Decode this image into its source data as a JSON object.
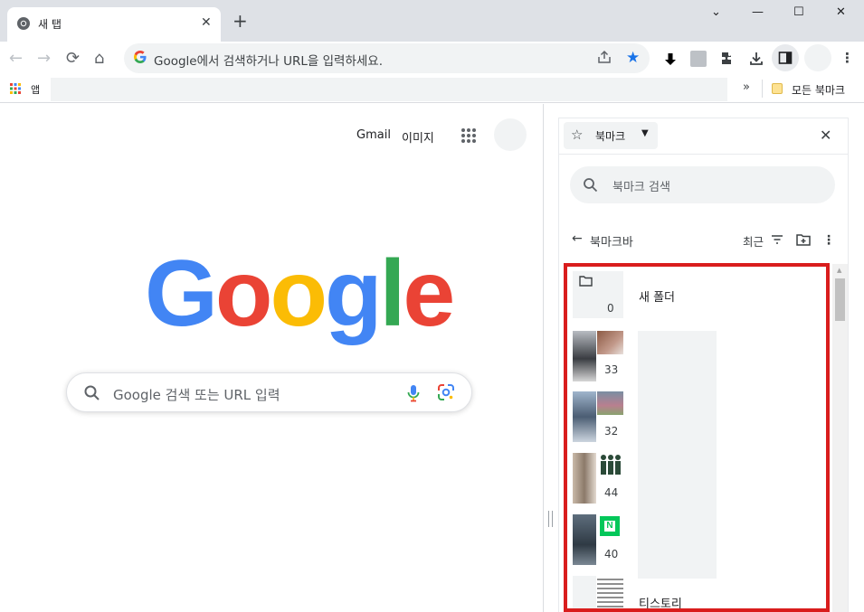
{
  "tab": {
    "title": "새 탭",
    "close": "✕"
  },
  "newtab": "+",
  "window": {
    "minimize": "—",
    "maximize": "☐",
    "close": "✕",
    "dropdown": "⌄"
  },
  "nav": {
    "back": "←",
    "forward": "→",
    "reload": "⟳",
    "home": "⌂"
  },
  "omnibox": {
    "placeholder": "Google에서 검색하거나 URL을 입력하세요."
  },
  "bookmarksbar": {
    "apps_label": "앱",
    "overflow": "»",
    "all_bookmarks": "모든 북마크"
  },
  "google": {
    "gmail": "Gmail",
    "images": "이미지",
    "logo": [
      {
        "ch": "G",
        "color": "#4285F4"
      },
      {
        "ch": "o",
        "color": "#EA4335"
      },
      {
        "ch": "o",
        "color": "#FBBC05"
      },
      {
        "ch": "g",
        "color": "#4285F4"
      },
      {
        "ch": "l",
        "color": "#34A853"
      },
      {
        "ch": "e",
        "color": "#EA4335"
      }
    ],
    "search_placeholder": "Google 검색 또는 URL 입력"
  },
  "panel": {
    "title": "북마크",
    "search_placeholder": "북마크 검색",
    "folder_path": "북마크바",
    "sort_label": "최근",
    "items": [
      {
        "name": "새 폴더",
        "count": "0"
      },
      {
        "name": "",
        "count": "33"
      },
      {
        "name": "",
        "count": "32"
      },
      {
        "name": "",
        "count": "44"
      },
      {
        "name": "",
        "count": "40"
      },
      {
        "name": "티스토리",
        "count": ""
      }
    ]
  },
  "colors": {
    "highlight": "#d91d1d",
    "accent": "#1a73e8"
  }
}
